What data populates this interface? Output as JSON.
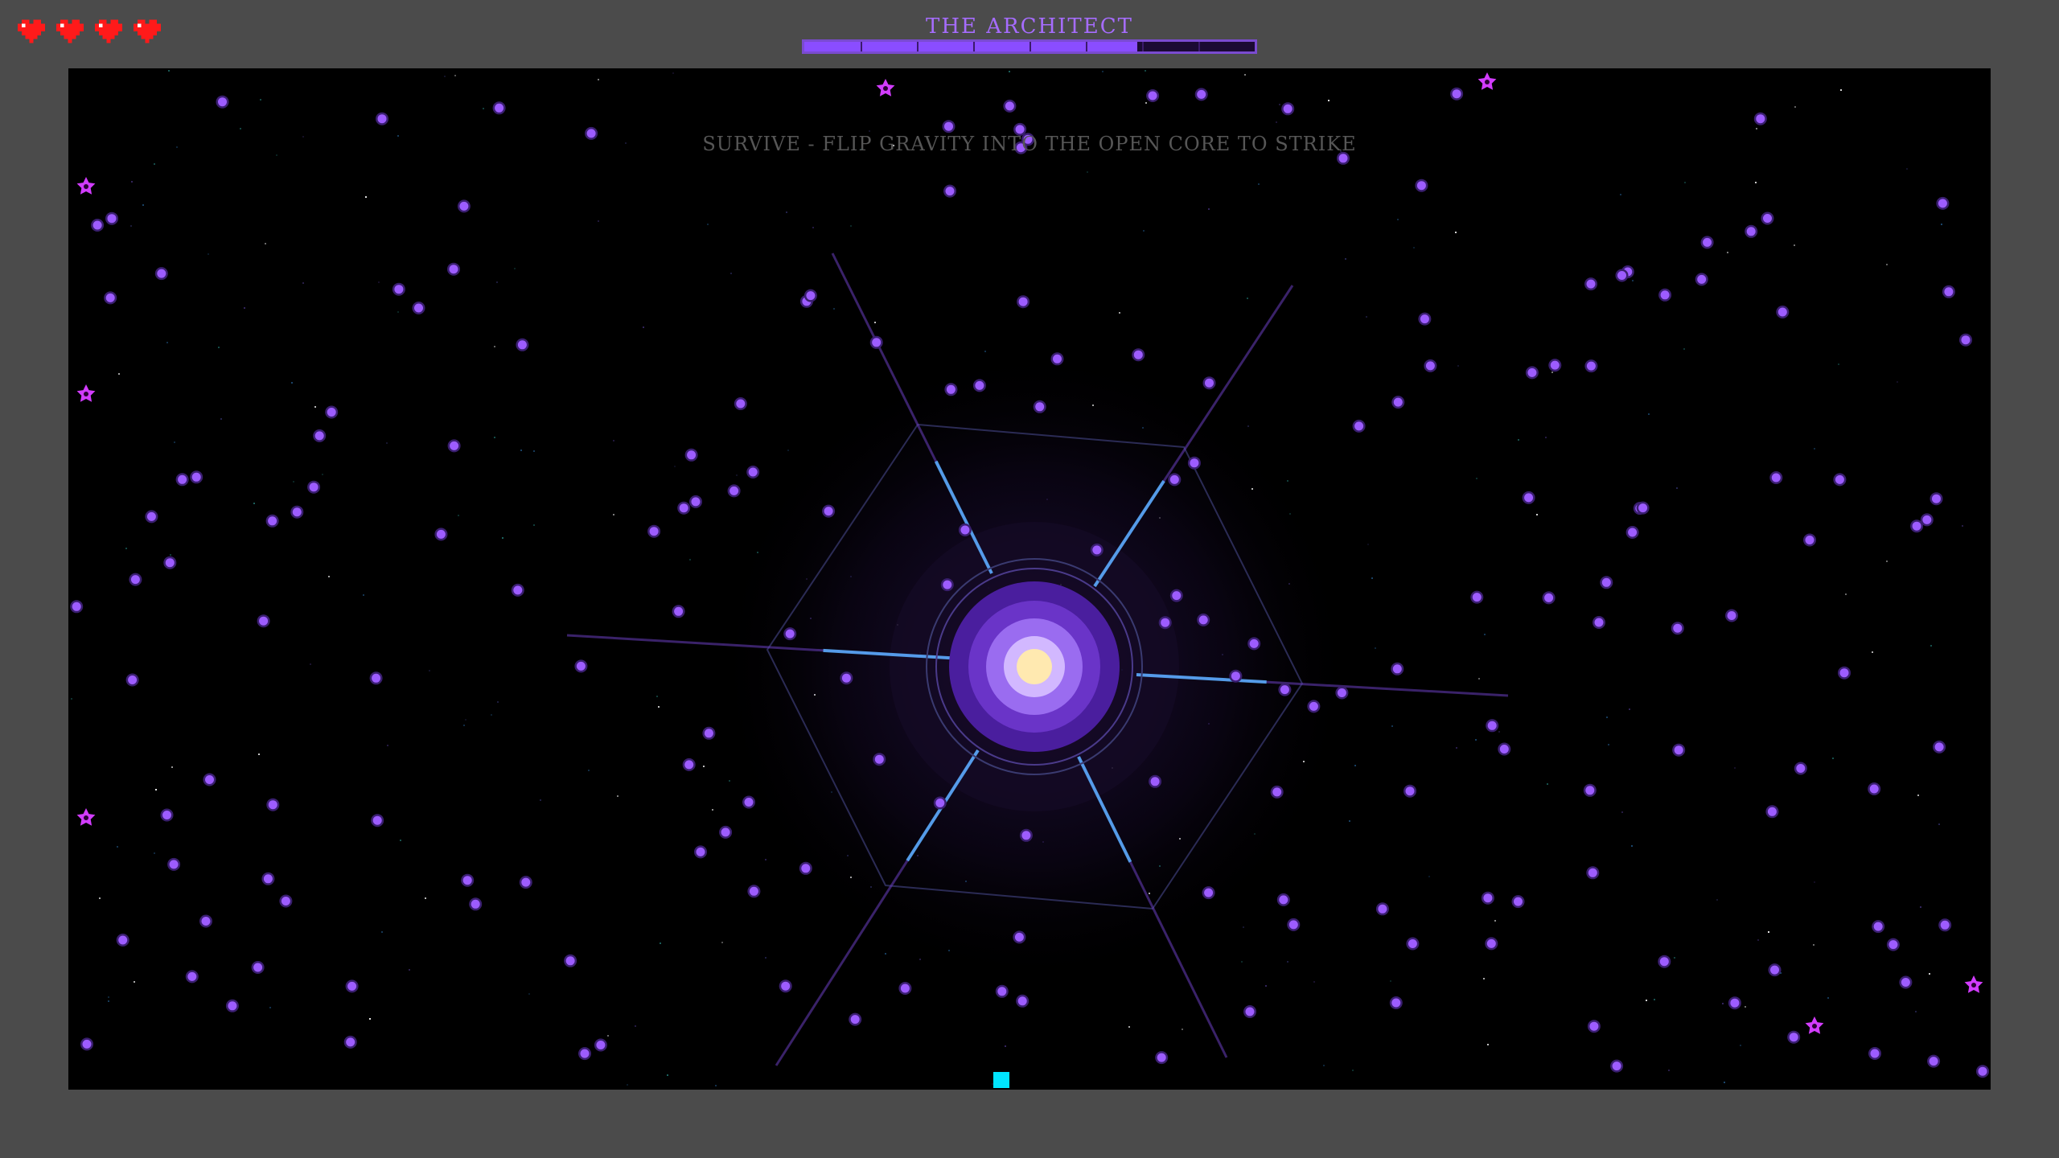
{
  "hud": {
    "lives": 4,
    "heart_icon": "heart-icon",
    "heart_color": "#ff1a1a"
  },
  "boss": {
    "name": "THE ARCHITECT",
    "health_fraction": 0.74,
    "health_segments": 8,
    "bar_color": "#8a4dff"
  },
  "objective": {
    "text": "SURVIVE - FLIP GRAVITY INTO THE OPEN CORE TO STRIKE"
  },
  "colors": {
    "orb": "#9d5cff",
    "spiky_enemy": "#d23cff",
    "player": "#00e5ff",
    "core_glow": "#ffe9b0",
    "arena_bg": "#000000",
    "frame_bg": "#4b4b4b"
  },
  "icons": {
    "player": "player-square-icon",
    "enemy": "spiky-star-icon",
    "projectile": "orb-icon"
  }
}
